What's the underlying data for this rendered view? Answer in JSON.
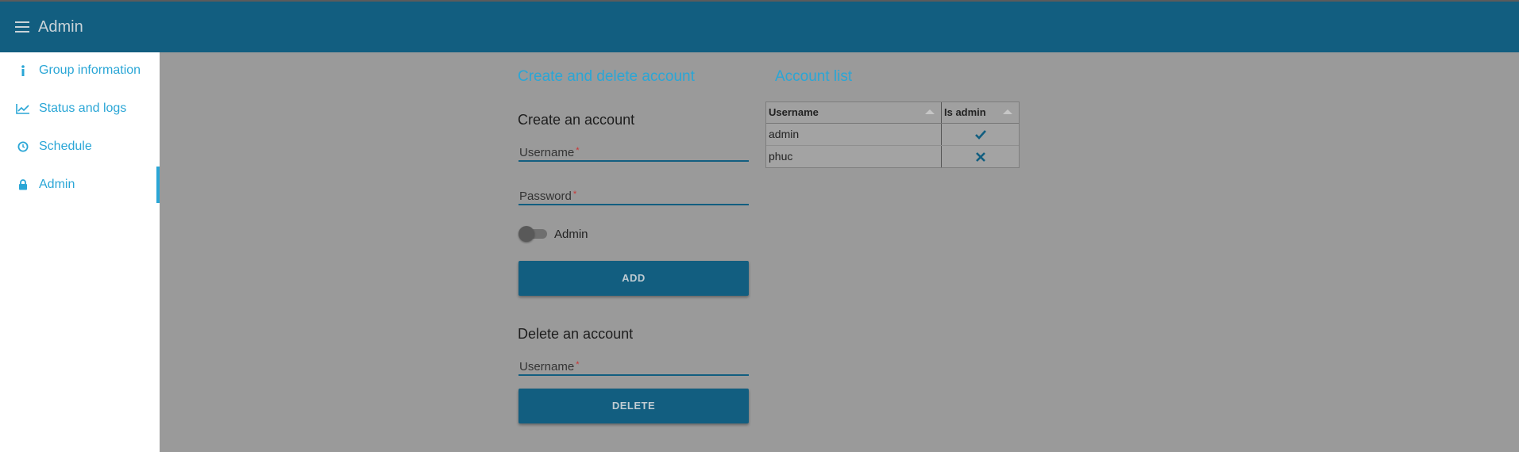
{
  "header": {
    "title": "Admin",
    "menu_icon": "hamburger-menu-icon"
  },
  "sidebar": {
    "items": [
      {
        "label": "Group information",
        "icon": "info-icon"
      },
      {
        "label": "Status and logs",
        "icon": "line-chart-icon"
      },
      {
        "label": "Schedule",
        "icon": "clock-icon"
      },
      {
        "label": "Admin",
        "icon": "lock-icon",
        "active": true
      }
    ]
  },
  "create_delete": {
    "title": "Create and delete account",
    "create": {
      "title": "Create an account",
      "username_label": "Username",
      "password_label": "Password",
      "required_mark": "*",
      "admin_toggle_label": "Admin",
      "admin_toggle_on": false,
      "add_label": "ADD"
    },
    "delete": {
      "title": "Delete an account",
      "username_label": "Username",
      "required_mark": "*",
      "delete_label": "DELETE"
    }
  },
  "account_list": {
    "title": "Account list",
    "columns": [
      "Username",
      "Is admin"
    ],
    "rows": [
      {
        "username": "admin",
        "is_admin": true
      },
      {
        "username": "phuc",
        "is_admin": false
      }
    ]
  },
  "colors": {
    "topbar": "#125e80",
    "accent": "#2aa6d6",
    "overlay_background": "#9a9a9a"
  }
}
